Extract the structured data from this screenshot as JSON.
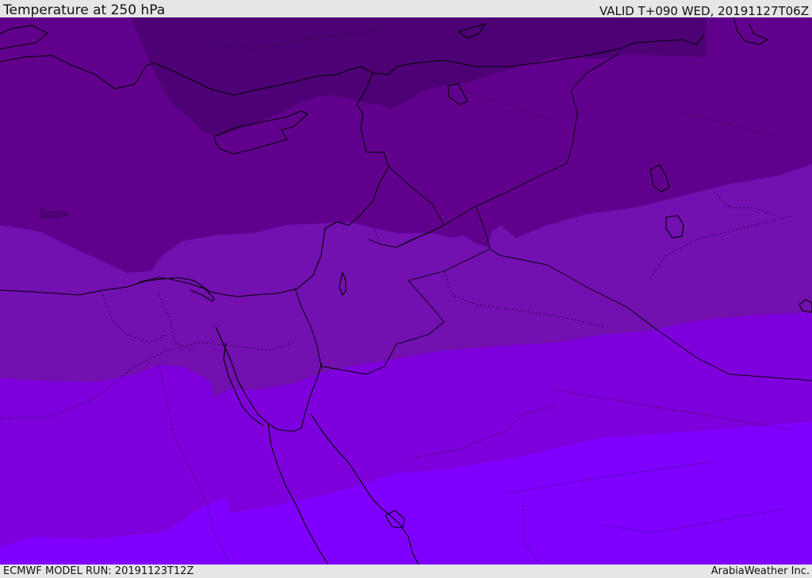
{
  "header": {
    "title": "Temperature at 250 hPa",
    "valid": "VALID T+090 WED, 20191127T06Z"
  },
  "footer": {
    "model_run": "ECMWF MODEL RUN: 20191123T12Z",
    "credit": "ArabiaWeather Inc."
  },
  "colors": {
    "band_darkest": "#4e0075",
    "band_dark": "#62008e",
    "band_mid": "#7210b0",
    "band_bright": "#7e00dc",
    "band_brightest": "#7f00ff",
    "coastline": "#000000",
    "border": "#000000",
    "chrome": "#e6e6e6"
  }
}
